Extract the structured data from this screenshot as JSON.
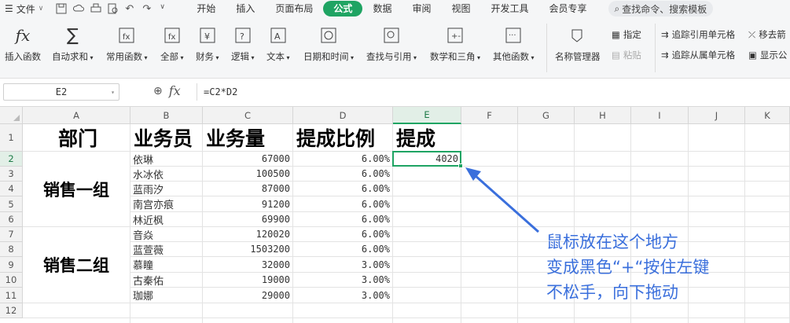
{
  "menubar": {
    "file_label": "文件",
    "tabs": [
      "开始",
      "插入",
      "页面布局",
      "公式",
      "数据",
      "审阅",
      "视图",
      "开发工具",
      "会员专享"
    ],
    "active_tab": "公式",
    "search_label": "查找命令、搜索模板"
  },
  "ribbon": {
    "insert_function": "插入函数",
    "autosum": "自动求和",
    "common_functions": "常用函数",
    "all": "全部",
    "finance": "财务",
    "logic": "逻辑",
    "text": "文本",
    "datetime": "日期和时间",
    "lookup": "查找与引用",
    "math": "数学和三角",
    "other": "其他函数",
    "name_manager": "名称管理器",
    "specify": "指定",
    "paste": "粘贴",
    "trace_precedents": "追踪引用单元格",
    "trace_dependents": "追踪从属单元格",
    "remove_arrows": "移去箭",
    "show_formulas": "显示公"
  },
  "formula_bar": {
    "name_box": "E2",
    "fx_label": "fx",
    "formula": "=C2*D2"
  },
  "columns": [
    "A",
    "B",
    "C",
    "D",
    "E",
    "F",
    "G",
    "H",
    "I",
    "J",
    "K"
  ],
  "rows": [
    "1",
    "2",
    "3",
    "4",
    "5",
    "6",
    "7",
    "8",
    "9",
    "10",
    "11",
    "12"
  ],
  "table": {
    "headers": [
      "部门",
      "业务员",
      "业务量",
      "提成比例",
      "提成"
    ],
    "groups": [
      "销售一组",
      "销售二组"
    ],
    "records": [
      {
        "name": "依琳",
        "volume": "67000",
        "rate": "6.00%"
      },
      {
        "name": "水冰依",
        "volume": "100500",
        "rate": "6.00%"
      },
      {
        "name": "蓝雨汐",
        "volume": "87000",
        "rate": "6.00%"
      },
      {
        "name": "南宫亦痕",
        "volume": "91200",
        "rate": "6.00%"
      },
      {
        "name": "林近枫",
        "volume": "69900",
        "rate": "6.00%"
      },
      {
        "name": "音焱",
        "volume": "120020",
        "rate": "6.00%"
      },
      {
        "name": "蓝萱薇",
        "volume": "1503200",
        "rate": "6.00%"
      },
      {
        "name": "慕瞳",
        "volume": "32000",
        "rate": "3.00%"
      },
      {
        "name": "古秦佑",
        "volume": "19000",
        "rate": "3.00%"
      },
      {
        "name": "珈娜",
        "volume": "29000",
        "rate": "3.00%"
      }
    ],
    "commission_e2": "4020"
  },
  "annotation": {
    "line1": "鼠标放在这个地方",
    "line2": "变成黑色“+“按住左键",
    "line3": "不松手，向下拖动"
  },
  "colors": {
    "accent": "#1fa463",
    "annotation": "#3a6fdc"
  }
}
